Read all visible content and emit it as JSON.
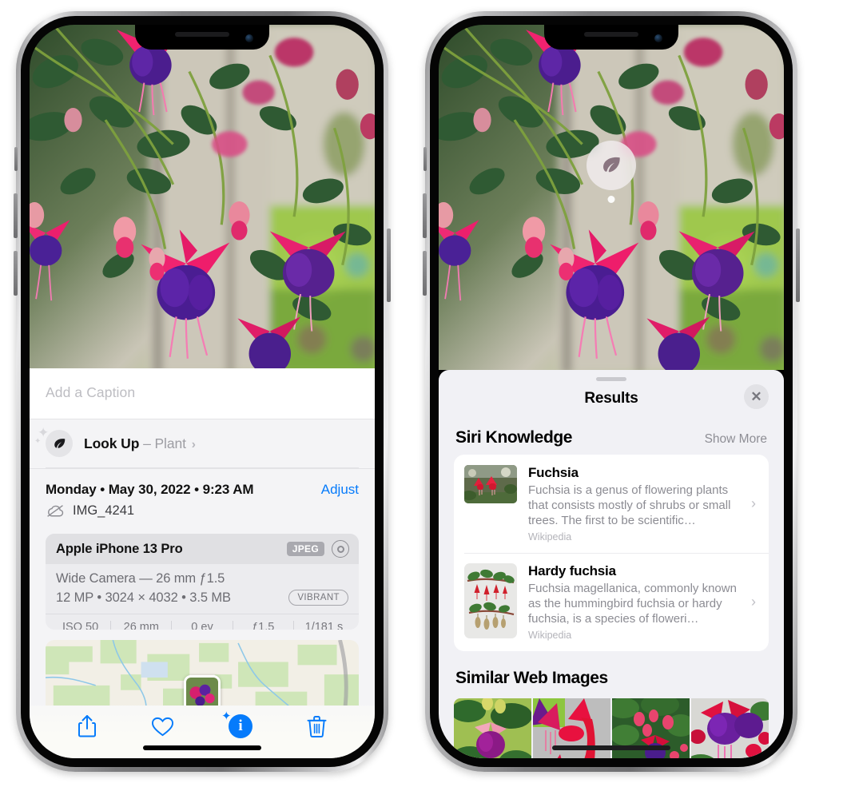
{
  "left_phone": {
    "caption_field": {
      "placeholder": "Add a Caption",
      "value": ""
    },
    "look_up": {
      "label": "Look Up",
      "dash": "–",
      "category": "Plant",
      "chevron": "›",
      "icon": "leaf-icon",
      "sparkle": "sparkles-icon"
    },
    "metadata": {
      "date_line": "Monday • May 30, 2022 • 9:23 AM",
      "adjust_label": "Adjust",
      "filename": "IMG_4241",
      "cloud_icon": "icloud-slash-icon"
    },
    "exif": {
      "device": "Apple iPhone 13 Pro",
      "format_tag": "JPEG",
      "lens_icon": "lens-ring-icon",
      "lens_line": "Wide Camera — 26 mm ƒ1.5",
      "size_line": "12 MP • 3024 × 4032 • 3.5 MB",
      "style_tag": "VIBRANT",
      "stats": [
        "ISO 50",
        "26 mm",
        "0 ev",
        "ƒ1.5",
        "1/181 s"
      ]
    },
    "map": {
      "pin_label": "photo-pin"
    },
    "toolbar": [
      {
        "name": "share-button",
        "icon": "share-icon"
      },
      {
        "name": "favorite-button",
        "icon": "heart-icon"
      },
      {
        "name": "info-button",
        "icon": "info-sparkle-icon"
      },
      {
        "name": "delete-button",
        "icon": "trash-icon"
      }
    ]
  },
  "right_phone": {
    "visual_lookup_badge": {
      "icon": "leaf-icon"
    },
    "results_sheet": {
      "title": "Results",
      "close_label": "✕",
      "sections": [
        {
          "title": "Siri Knowledge",
          "action": "Show More",
          "items": [
            {
              "name": "Fuchsia",
              "description": "Fuchsia is a genus of flowering plants that consists mostly of shrubs or small trees. The first to be scientific…",
              "source": "Wikipedia",
              "chevron": "›",
              "thumb": "landscape"
            },
            {
              "name": "Hardy fuchsia",
              "description": "Fuchsia magellanica, commonly known as the hummingbird fuchsia or hardy fuchsia, is a species of floweri…",
              "source": "Wikipedia",
              "chevron": "›",
              "thumb": "portrait"
            }
          ]
        },
        {
          "title": "Similar Web Images",
          "thumbs": [
            "web-image-1",
            "web-image-2",
            "web-image-3",
            "web-image-4"
          ]
        }
      ]
    }
  },
  "colors": {
    "accent_blue": "#067bfb",
    "sheet_bg": "#f4f4f6",
    "results_bg": "#f1f1f5",
    "card_white": "#ffffff",
    "secondary_text": "#8c8c93"
  }
}
